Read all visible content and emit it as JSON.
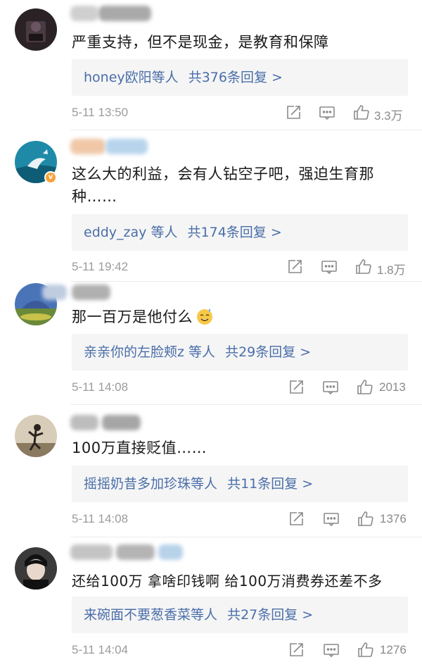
{
  "comments": [
    {
      "text": "严重支持，但不是现金，是教育和保障",
      "reply_user": "honey欧阳等人",
      "reply_count": "共376条回复 >",
      "time": "5-11 13:50",
      "likes": "3.3万"
    },
    {
      "text": "这么大的利益，会有人钻空子吧，强迫生育那种……",
      "reply_user": "eddy_zay 等人",
      "reply_count": "共174条回复 >",
      "time": "5-11 19:42",
      "likes": "1.8万",
      "verified": true
    },
    {
      "text": "那一百万是他付么",
      "reply_user": "亲亲你的左脸颊z 等人",
      "reply_count": "共29条回复 >",
      "time": "5-11 14:08",
      "likes": "2013"
    },
    {
      "text": "100万直接贬值……",
      "reply_user": "摇摇奶昔多加珍珠等人",
      "reply_count": "共11条回复 >",
      "time": "5-11 14:08",
      "likes": "1376"
    },
    {
      "text": "还给100万 拿啥印钱啊 给100万消费券还差不多",
      "reply_user": "来碗面不要葱香菜等人",
      "reply_count": "共27条回复 >",
      "time": "5-11 14:04",
      "likes": "1276"
    }
  ],
  "icons": {
    "share": "share-icon",
    "comment": "comment-icon",
    "like": "thumbs-up-icon",
    "verified": "verified-badge-icon"
  },
  "colors": {
    "reply_link": "#4a6ea9",
    "meta_gray": "#9b9b9b",
    "reply_bg": "#f5f5f5",
    "verified_badge": "#f6a23a"
  }
}
